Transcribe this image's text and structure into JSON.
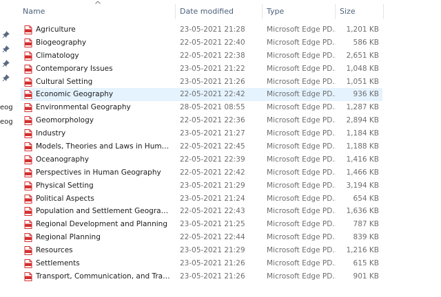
{
  "nav_pane": {
    "items": [
      {
        "label": "eog"
      },
      {
        "label": "eog"
      }
    ]
  },
  "columns": {
    "name": "Name",
    "date": "Date modified",
    "type": "Type",
    "size": "Size"
  },
  "sort": {
    "column": "name",
    "direction": "ascending"
  },
  "accent_colors": {
    "selection": "#e5f3ff",
    "header_text": "#4c607a",
    "pdf_icon": "#d32f2f"
  },
  "files": [
    {
      "name": "Agriculture",
      "date": "23-05-2021 21:28",
      "type": "Microsoft Edge PD...",
      "size": "1,201 KB"
    },
    {
      "name": "Biogeography",
      "date": "22-05-2021 22:40",
      "type": "Microsoft Edge PD...",
      "size": "586 KB"
    },
    {
      "name": "Climatology",
      "date": "22-05-2021 22:38",
      "type": "Microsoft Edge PD...",
      "size": "2,651 KB"
    },
    {
      "name": "Contemporary Issues",
      "date": "23-05-2021 21:22",
      "type": "Microsoft Edge PD...",
      "size": "1,048 KB"
    },
    {
      "name": "Cultural Setting",
      "date": "23-05-2021 21:26",
      "type": "Microsoft Edge PD...",
      "size": "1,051 KB"
    },
    {
      "name": "Economic Geography",
      "date": "22-05-2021 22:42",
      "type": "Microsoft Edge PD...",
      "size": "936 KB",
      "selected": true
    },
    {
      "name": "Environmental Geography",
      "date": "28-05-2021 08:55",
      "type": "Microsoft Edge PD...",
      "size": "1,287 KB"
    },
    {
      "name": "Geomorphology",
      "date": "22-05-2021 22:36",
      "type": "Microsoft Edge PD...",
      "size": "2,894 KB"
    },
    {
      "name": "Industry",
      "date": "23-05-2021 21:27",
      "type": "Microsoft Edge PD...",
      "size": "1,184 KB"
    },
    {
      "name": "Models, Theories and Laws in Human Ge...",
      "date": "22-05-2021 22:45",
      "type": "Microsoft Edge PD...",
      "size": "1,188 KB"
    },
    {
      "name": "Oceanography",
      "date": "22-05-2021 22:39",
      "type": "Microsoft Edge PD...",
      "size": "1,416 KB"
    },
    {
      "name": "Perspectives in Human Geography",
      "date": "22-05-2021 22:42",
      "type": "Microsoft Edge PD...",
      "size": "1,466 KB"
    },
    {
      "name": "Physical Setting",
      "date": "23-05-2021 21:29",
      "type": "Microsoft Edge PD...",
      "size": "3,194 KB"
    },
    {
      "name": "Political Aspects",
      "date": "23-05-2021 21:24",
      "type": "Microsoft Edge PD...",
      "size": "654 KB"
    },
    {
      "name": "Population and Settlement Geography",
      "date": "22-05-2021 22:43",
      "type": "Microsoft Edge PD...",
      "size": "1,636 KB"
    },
    {
      "name": "Regional Development and Planning",
      "date": "23-05-2021 21:25",
      "type": "Microsoft Edge PD...",
      "size": "787 KB"
    },
    {
      "name": "Regional Planning",
      "date": "22-05-2021 22:44",
      "type": "Microsoft Edge PD...",
      "size": "839 KB"
    },
    {
      "name": "Resources",
      "date": "23-05-2021 21:29",
      "type": "Microsoft Edge PD...",
      "size": "1,216 KB"
    },
    {
      "name": "Settlements",
      "date": "23-05-2021 21:26",
      "type": "Microsoft Edge PD...",
      "size": "615 KB"
    },
    {
      "name": "Transport, Communication, and Trade",
      "date": "23-05-2021 21:26",
      "type": "Microsoft Edge PD...",
      "size": "901 KB"
    }
  ]
}
